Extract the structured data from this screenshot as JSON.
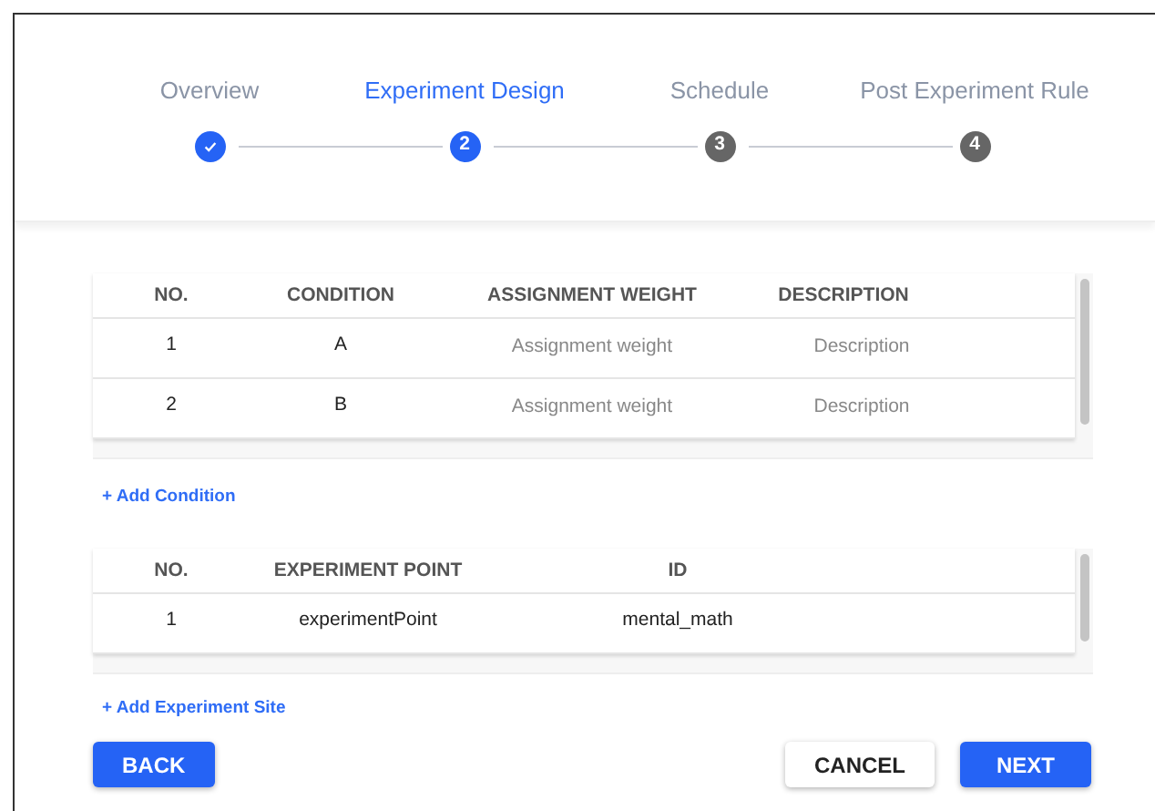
{
  "stepper": [
    {
      "label": "Overview",
      "completed": true,
      "selected": false
    },
    {
      "label": "Experiment Design",
      "completed": false,
      "selected": true,
      "number": "2"
    },
    {
      "label": "Schedule",
      "completed": false,
      "selected": false,
      "number": "3"
    },
    {
      "label": "Post Experiment Rule",
      "completed": false,
      "selected": false,
      "number": "4"
    }
  ],
  "conditions_table": {
    "columns": [
      "NO.",
      "CONDITION",
      "ASSIGNMENT WEIGHT",
      "DESCRIPTION"
    ],
    "rows": [
      [
        {
          "kind": "text",
          "text": "1"
        },
        {
          "kind": "text",
          "text": "A"
        },
        {
          "kind": "input",
          "placeholder": "Assignment weight"
        },
        {
          "kind": "input",
          "placeholder": "Description"
        }
      ],
      [
        {
          "kind": "text",
          "text": "2"
        },
        {
          "kind": "text",
          "text": "B"
        },
        {
          "kind": "input",
          "placeholder": "Assignment weight"
        },
        {
          "kind": "input",
          "placeholder": "Description"
        }
      ]
    ]
  },
  "add_condition": "+ Add Condition",
  "experiment_points_table": {
    "columns": [
      "NO.",
      "EXPERIMENT POINT",
      "ID"
    ],
    "rows": [
      [
        {
          "kind": "text",
          "text": "1"
        },
        {
          "kind": "text",
          "text": "experimentPoint"
        },
        {
          "kind": "text",
          "text": "mental_math"
        }
      ]
    ]
  },
  "add_experiment_site": "+ Add Experiment Site",
  "buttons": [
    {
      "label": "BACK",
      "kind": "primary"
    },
    {
      "label": "CANCEL",
      "kind": "secondary"
    },
    {
      "label": "NEXT",
      "kind": "primary"
    }
  ]
}
